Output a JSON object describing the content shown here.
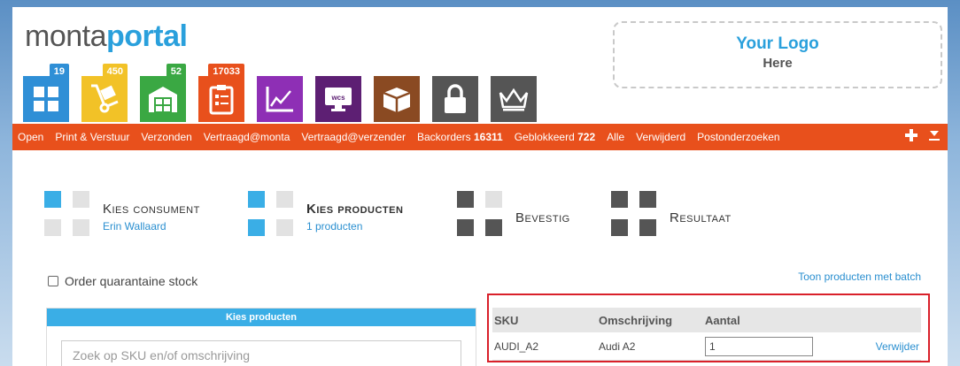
{
  "logo": {
    "part1": "monta",
    "part2": "portal"
  },
  "your_logo": {
    "line1": "Your Logo",
    "line2": "Here"
  },
  "apps": [
    {
      "icon": "tiles-icon",
      "color": "#2f8fd6",
      "badge": "19",
      "badge_color": "#2f8fd6"
    },
    {
      "icon": "hand-truck-icon",
      "color": "#f2c227",
      "badge": "450",
      "badge_color": "#f2c227"
    },
    {
      "icon": "warehouse-icon",
      "color": "#3aa843",
      "badge": "52",
      "badge_color": "#3aa843"
    },
    {
      "icon": "clipboard-icon",
      "color": "#e8501c",
      "badge": "17033",
      "badge_color": "#e8501c"
    },
    {
      "icon": "line-chart-icon",
      "color": "#8e2fb5",
      "badge": "",
      "badge_color": ""
    },
    {
      "icon": "wcs-monitor-icon",
      "color": "#5d1f73",
      "badge": "",
      "badge_color": "",
      "label": "wcs"
    },
    {
      "icon": "box-icon",
      "color": "#8a4a22",
      "badge": "",
      "badge_color": ""
    },
    {
      "icon": "lock-icon",
      "color": "#555555",
      "badge": "",
      "badge_color": ""
    },
    {
      "icon": "crown-icon",
      "color": "#555555",
      "badge": "",
      "badge_color": ""
    }
  ],
  "nav": {
    "items": [
      {
        "label": "Open",
        "count": ""
      },
      {
        "label": "Print & Verstuur",
        "count": ""
      },
      {
        "label": "Verzonden",
        "count": ""
      },
      {
        "label": "Vertraagd@monta",
        "count": ""
      },
      {
        "label": "Vertraagd@verzender",
        "count": ""
      },
      {
        "label": "Backorders ",
        "count": "16311"
      },
      {
        "label": "Geblokkeerd ",
        "count": "722"
      },
      {
        "label": "Alle",
        "count": ""
      },
      {
        "label": "Verwijderd",
        "count": ""
      },
      {
        "label": "Postonderzoeken",
        "count": ""
      }
    ]
  },
  "steps": [
    {
      "title": "Kies consument",
      "sub": "Erin Wallaard",
      "bold": false
    },
    {
      "title": "Kies producten",
      "sub": "1 producten",
      "bold": true
    },
    {
      "title": "Bevestig",
      "sub": "",
      "bold": false
    },
    {
      "title": "Resultaat",
      "sub": "",
      "bold": false
    }
  ],
  "quarantine_label": "Order quarantaine stock",
  "toon_link": "Toon producten met batch",
  "kies_panel": {
    "title": "Kies producten",
    "search_placeholder": "Zoek op SKU en/of omschrijving"
  },
  "selected": {
    "headers": {
      "sku": "SKU",
      "omschrijving": "Omschrijving",
      "aantal": "Aantal"
    },
    "rows": [
      {
        "sku": "AUDI_A2",
        "omschrijving": "Audi A2",
        "aantal": "1",
        "action": "Verwijder"
      }
    ]
  },
  "colors": {
    "accent": "#e8501c",
    "link": "#2a8fd0",
    "brand_blue": "#2aa0dc",
    "highlight_border": "#d9202a"
  }
}
